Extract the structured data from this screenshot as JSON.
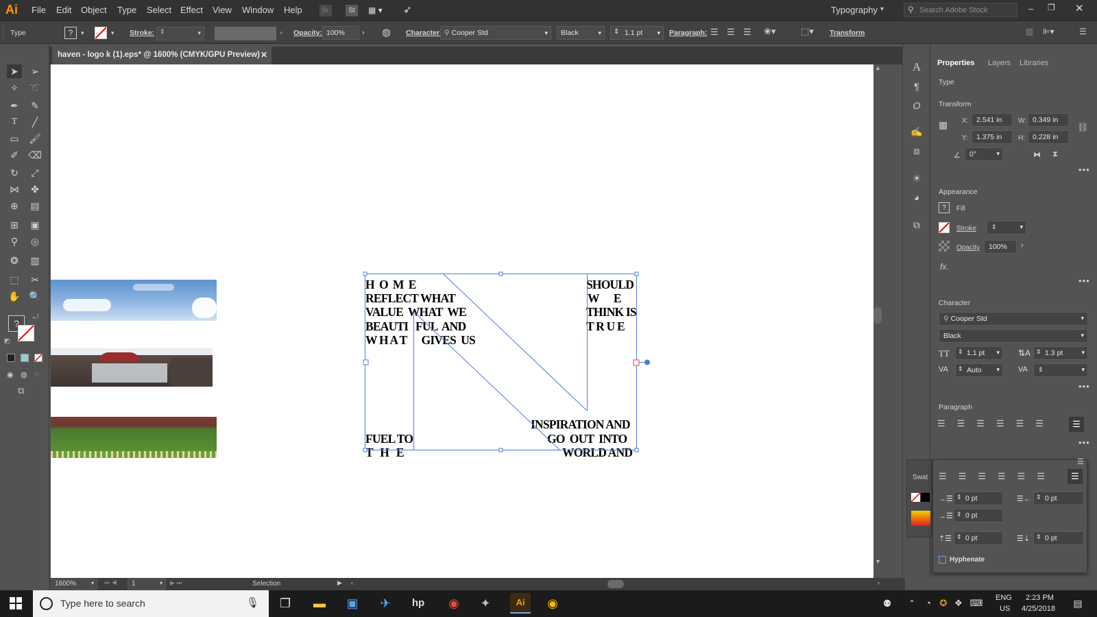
{
  "app": {
    "logo": "Ai",
    "workspace": "Typography",
    "search_placeholder": "Search Adobe Stock"
  },
  "menu": [
    "File",
    "Edit",
    "Object",
    "Type",
    "Select",
    "Effect",
    "View",
    "Window",
    "Help"
  ],
  "control_bar": {
    "type_label": "Type",
    "stroke_label": "Stroke:",
    "opacity_label": "Opacity:",
    "opacity_value": "100%",
    "character_label": "Character:",
    "font": "Cooper Std",
    "style": "Black",
    "size": "1.1 pt",
    "paragraph_label": "Paragraph:",
    "transform_label": "Transform"
  },
  "document_tab": {
    "title": "haven - logo k (1).eps* @ 1600% (CMYK/GPU Preview)"
  },
  "artwork_text": {
    "col1": [
      "H  O  M  E",
      "REFLECT WHAT",
      "VALUE  WHAT  WE",
      "BEAUTI   FUL  AND",
      "W H A T      GIVES  US"
    ],
    "col3": [
      "SHOULD",
      "W      E",
      "THINK IS",
      "T R U E"
    ],
    "bottom_left": [
      "FUEL TO",
      "T   H   E"
    ],
    "bottom_right": [
      "INSPIRATION AND",
      "GO  OUT  INTO",
      "WORLD AND"
    ]
  },
  "status_bar": {
    "zoom": "1600%",
    "page": "1",
    "tool": "Selection"
  },
  "panel": {
    "tabs": [
      "Properties",
      "Layers",
      "Libraries"
    ],
    "type_label": "Type",
    "transform": {
      "heading": "Transform",
      "x_label": "X:",
      "x": "2.541 in",
      "y_label": "Y:",
      "y": "1.375 in",
      "w_label": "W:",
      "w": "0.349 in",
      "h_label": "H:",
      "h": "0.228 in",
      "angle": "0°"
    },
    "appearance": {
      "heading": "Appearance",
      "fill": "Fill",
      "stroke": "Stroke",
      "opacity_label": "Opacity",
      "opacity": "100%",
      "fx": "fx."
    },
    "character": {
      "heading": "Character",
      "font": "Cooper Std",
      "style": "Black",
      "size": "1.1 pt",
      "leading": "1.3 pt",
      "tracking": "Auto"
    },
    "paragraph": {
      "heading": "Paragraph",
      "indents": [
        "0 pt",
        "0 pt",
        "0 pt",
        "0 pt",
        "0 pt"
      ],
      "hyphenate": "Hyphenate"
    },
    "swatches_label": "Swat"
  },
  "taskbar": {
    "search_placeholder": "Type here to search",
    "lang1": "ENG",
    "lang2": "US",
    "time": "2:23 PM",
    "date": "4/25/2018"
  },
  "colors": {
    "selection": "#4a7cde",
    "accent": "#ff9a00",
    "dark": "#323232"
  }
}
